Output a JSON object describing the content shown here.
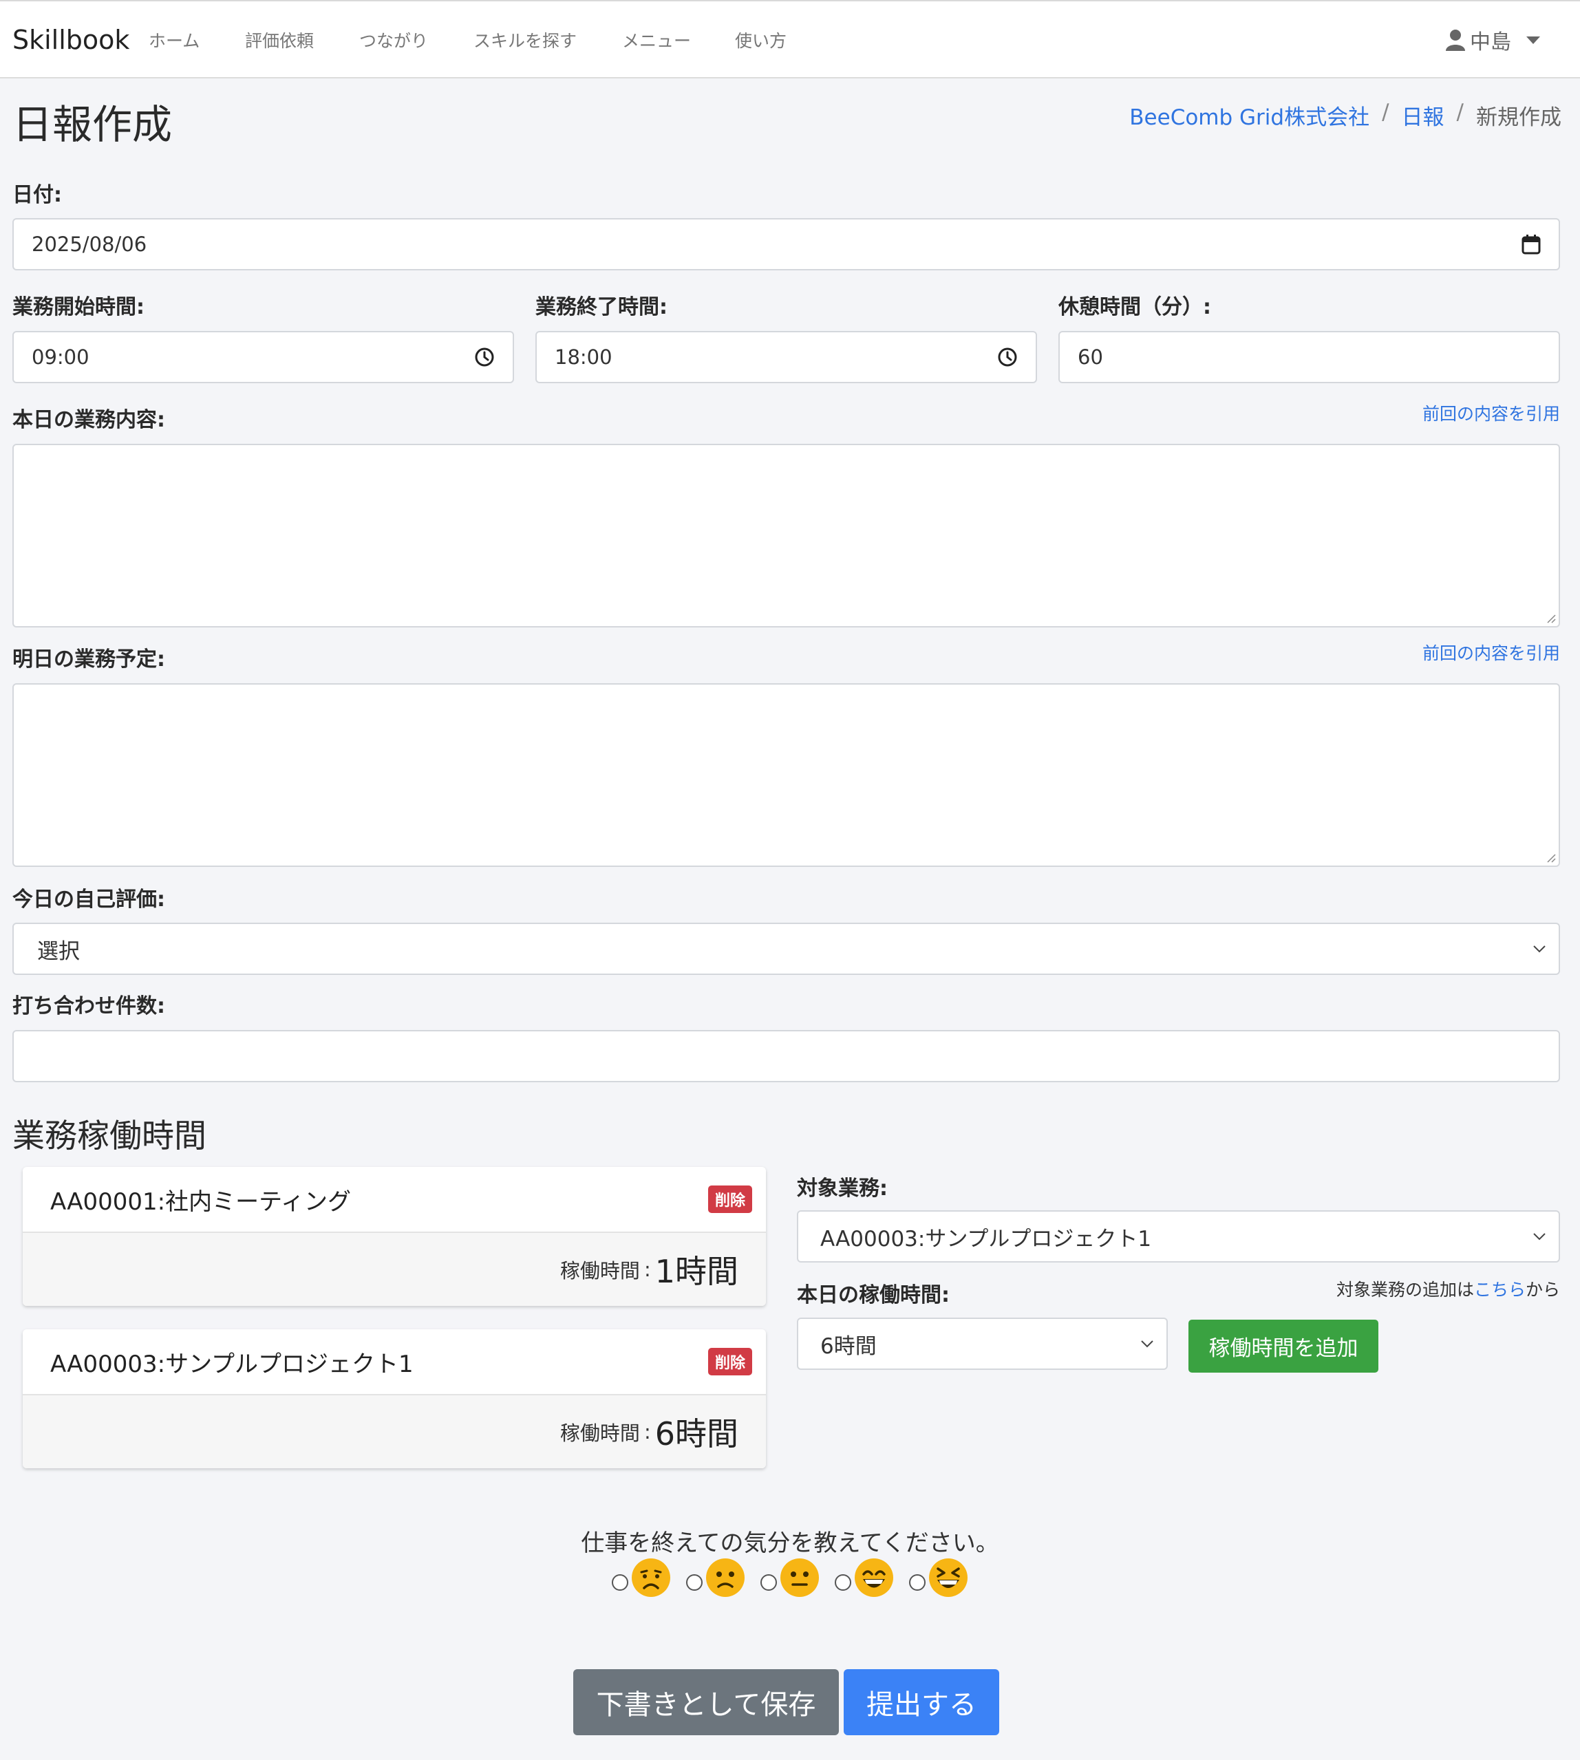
{
  "navbar": {
    "brand": "Skillbook",
    "links": [
      "ホーム",
      "評価依頼",
      "つながり",
      "スキルを探す",
      "メニュー",
      "使い方"
    ],
    "user_name": "中島"
  },
  "page": {
    "title": "日報作成",
    "breadcrumb": [
      "BeeComb Grid株式会社",
      "日報",
      "新規作成"
    ]
  },
  "form": {
    "date_label": "日付:",
    "date_value": "2025/08/06",
    "start_label": "業務開始時間:",
    "start_value": "09:00",
    "end_label": "業務終了時間:",
    "end_value": "18:00",
    "break_label": "休憩時間（分）:",
    "break_value": "60",
    "today_label": "本日の業務内容:",
    "today_quote": "前回の内容を引用",
    "tomorrow_label": "明日の業務予定:",
    "tomorrow_quote": "前回の内容を引用",
    "self_eval_label": "今日の自己評価:",
    "self_eval_value": "選択",
    "meetings_label": "打ち合わせ件数:",
    "meetings_value": ""
  },
  "worktime": {
    "heading": "業務稼働時間",
    "entries": [
      {
        "name": "AA00001:社内ミーティング",
        "delete": "削除",
        "hours_label": "稼働時間",
        "colon": ":",
        "hours": "1時間"
      },
      {
        "name": "AA00003:サンプルプロジェクト1",
        "delete": "削除",
        "hours_label": "稼働時間",
        "colon": ":",
        "hours": "6時間"
      }
    ],
    "target_label": "対象業務:",
    "target_value": "AA00003:サンプルプロジェクト1",
    "hours_label": "本日の稼働時間:",
    "note_prefix": "対象業務の追加は",
    "note_link": "こちら",
    "note_suffix": "から",
    "hours_value": "6時間",
    "add_button": "稼働時間を追加"
  },
  "mood": {
    "prompt": "仕事を終えての気分を教えてください。",
    "options": [
      "very-sad-face-icon",
      "sad-face-icon",
      "neutral-face-icon",
      "happy-face-icon",
      "very-happy-face-icon"
    ]
  },
  "actions": {
    "draft": "下書きとして保存",
    "submit": "提出する"
  },
  "colors": {
    "link": "#2f74e0",
    "danger": "#d13b45",
    "success": "#3aa241",
    "secondary": "#6c757d",
    "primary": "#3b82f6",
    "emoji": "#f7b514"
  }
}
